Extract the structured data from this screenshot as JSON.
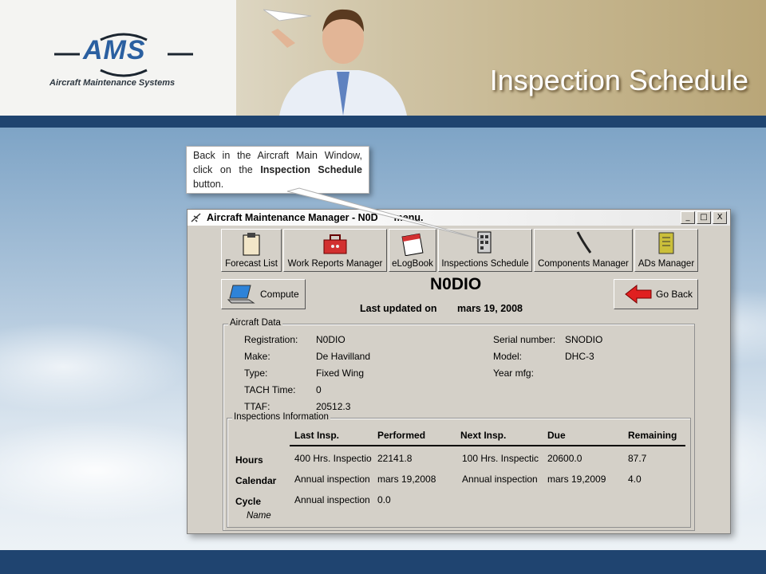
{
  "slide": {
    "title": "Inspection Schedule",
    "logo_text": "AMS",
    "logo_subtitle": "Aircraft Maintenance Systems",
    "callout": {
      "text_before": "Back in the Aircraft Main Window, click on the ",
      "bold": "Inspection Schedule",
      "text_after": " button."
    }
  },
  "window": {
    "title": "Aircraft Maintenance Manager - N0D",
    "title_tail": "menu.",
    "controls": [
      "_",
      "□",
      "X"
    ],
    "toolbar": [
      {
        "label": "Forecast List",
        "icon": "clipboard-icon"
      },
      {
        "label": "Work Reports Manager",
        "icon": "toolbox-icon"
      },
      {
        "label": "eLogBook",
        "icon": "calendar-icon"
      },
      {
        "label": "Inspections Schedule",
        "icon": "schedule-icon"
      },
      {
        "label": "Components Manager",
        "icon": "wrench-icon"
      },
      {
        "label": "ADs Manager",
        "icon": "notebook-icon"
      }
    ],
    "compute_label": "Compute",
    "go_back_label": "Go Back",
    "registration_title": "N0DIO",
    "last_updated_label": "Last updated on",
    "last_updated_value": "mars 19, 2008"
  },
  "aircraft_data": {
    "group_label": "Aircraft Data",
    "fields": {
      "registration": {
        "label": "Registration:",
        "value": "N0DIO"
      },
      "make": {
        "label": "Make:",
        "value": "De Havilland"
      },
      "type": {
        "label": "Type:",
        "value": "Fixed Wing"
      },
      "tach": {
        "label": "TACH Time:",
        "value": "0"
      },
      "ttaf": {
        "label": "TTAF:",
        "value": "20512.3"
      },
      "serial": {
        "label": "Serial number:",
        "value": "SNODIO"
      },
      "model": {
        "label": "Model:",
        "value": "DHC-3"
      },
      "year": {
        "label": "Year mfg:",
        "value": ""
      }
    }
  },
  "inspections": {
    "group_label": "Inspections Information",
    "columns": [
      "Last Insp.",
      "Performed",
      "Next Insp.",
      "Due",
      "Remaining"
    ],
    "rows": [
      {
        "label": "Hours",
        "cells": [
          "400 Hrs. Inspectio",
          "22141.8",
          "100 Hrs. Inspectic",
          "20600.0",
          "87.7"
        ]
      },
      {
        "label": "Calendar",
        "cells": [
          "Annual inspection",
          "mars 19,2008",
          "Annual inspection",
          "mars 19,2009",
          "4.0"
        ]
      },
      {
        "label": "Cycle",
        "cells": [
          "Annual inspection",
          "0.0",
          "",
          "",
          ""
        ]
      }
    ],
    "extra_label": "Name"
  }
}
